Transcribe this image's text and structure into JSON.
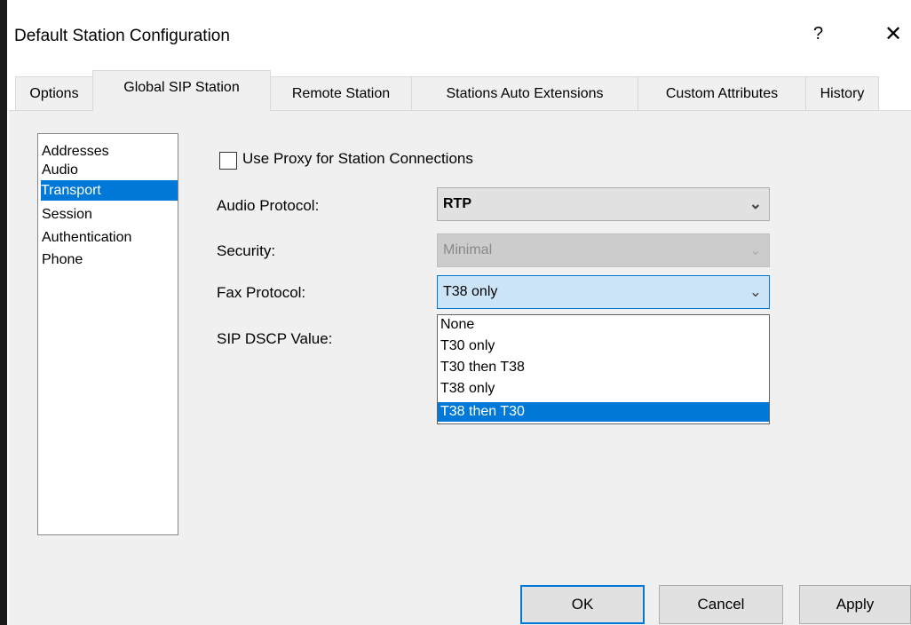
{
  "window": {
    "title": "Default Station Configuration",
    "help_label": "?",
    "close_label": "✕"
  },
  "tabs": [
    {
      "label": "Options"
    },
    {
      "label": "Global SIP Station",
      "active": true
    },
    {
      "label": "Remote Station"
    },
    {
      "label": "Stations Auto Extensions"
    },
    {
      "label": "Custom Attributes"
    },
    {
      "label": "History"
    }
  ],
  "categories": {
    "items": [
      "Addresses",
      "Audio",
      "Transport",
      "Session",
      "Authentication",
      "Phone"
    ],
    "selected": "Transport"
  },
  "form": {
    "use_proxy": {
      "label": "Use Proxy for Station Connections",
      "checked": false
    },
    "audio_protocol": {
      "label": "Audio Protocol:",
      "value": "RTP"
    },
    "security": {
      "label": "Security:",
      "value": "Minimal",
      "enabled": false
    },
    "fax_protocol": {
      "label": "Fax Protocol:",
      "value": "T38 only",
      "options": [
        "None",
        "T30 only",
        "T30 then T38",
        "T38 only",
        "T38 then T30"
      ],
      "highlighted": "T38 then T30"
    },
    "sip_dscp": {
      "label": "SIP DSCP Value:"
    }
  },
  "buttons": {
    "ok": "OK",
    "cancel": "Cancel",
    "apply": "Apply"
  },
  "icons": {
    "dropdown_arrow": "chevron-down-icon",
    "help": "help-icon",
    "close": "close-icon"
  },
  "colors": {
    "accent": "#0078d7",
    "panel": "#f0f0f0"
  }
}
